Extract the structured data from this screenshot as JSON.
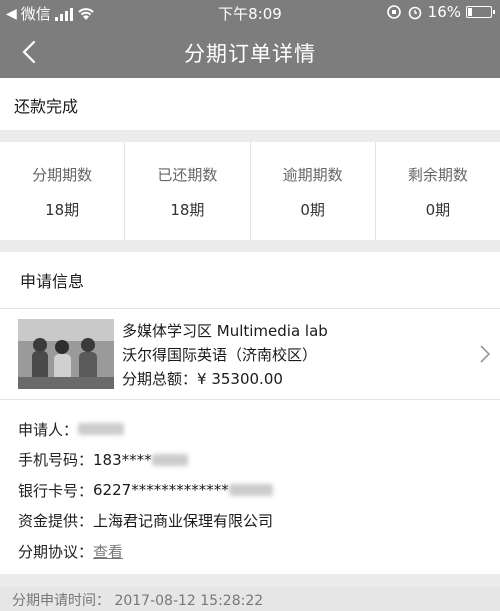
{
  "status_bar": {
    "carrier": "微信",
    "time": "下午8:09",
    "battery": "16%",
    "battery_level": 0.16
  },
  "nav": {
    "title": "分期订单详情"
  },
  "order_status": "还款完成",
  "stats": [
    {
      "label": "分期期数",
      "value": "18期"
    },
    {
      "label": "已还期数",
      "value": "18期"
    },
    {
      "label": "逾期期数",
      "value": "0期"
    },
    {
      "label": "剩余期数",
      "value": "0期"
    }
  ],
  "application": {
    "heading": "申请信息",
    "product": {
      "line1": "多媒体学习区 Multimedia lab",
      "line2": "沃尔得国际英语（济南校区）",
      "total_label": "分期总额：",
      "total_value": "¥ 35300.00"
    },
    "applicant_label": "申请人：",
    "phone_label": "手机号码：",
    "phone_value": "183****",
    "card_label": "银行卡号：",
    "card_value": "6227*************",
    "funder_label": "资金提供：",
    "funder_value": "上海君记商业保理有限公司",
    "agreement_label": "分期协议：",
    "agreement_link": "查看"
  },
  "footer": {
    "time_text": "分期申请时间：  2017-08-12 15:28:22"
  }
}
